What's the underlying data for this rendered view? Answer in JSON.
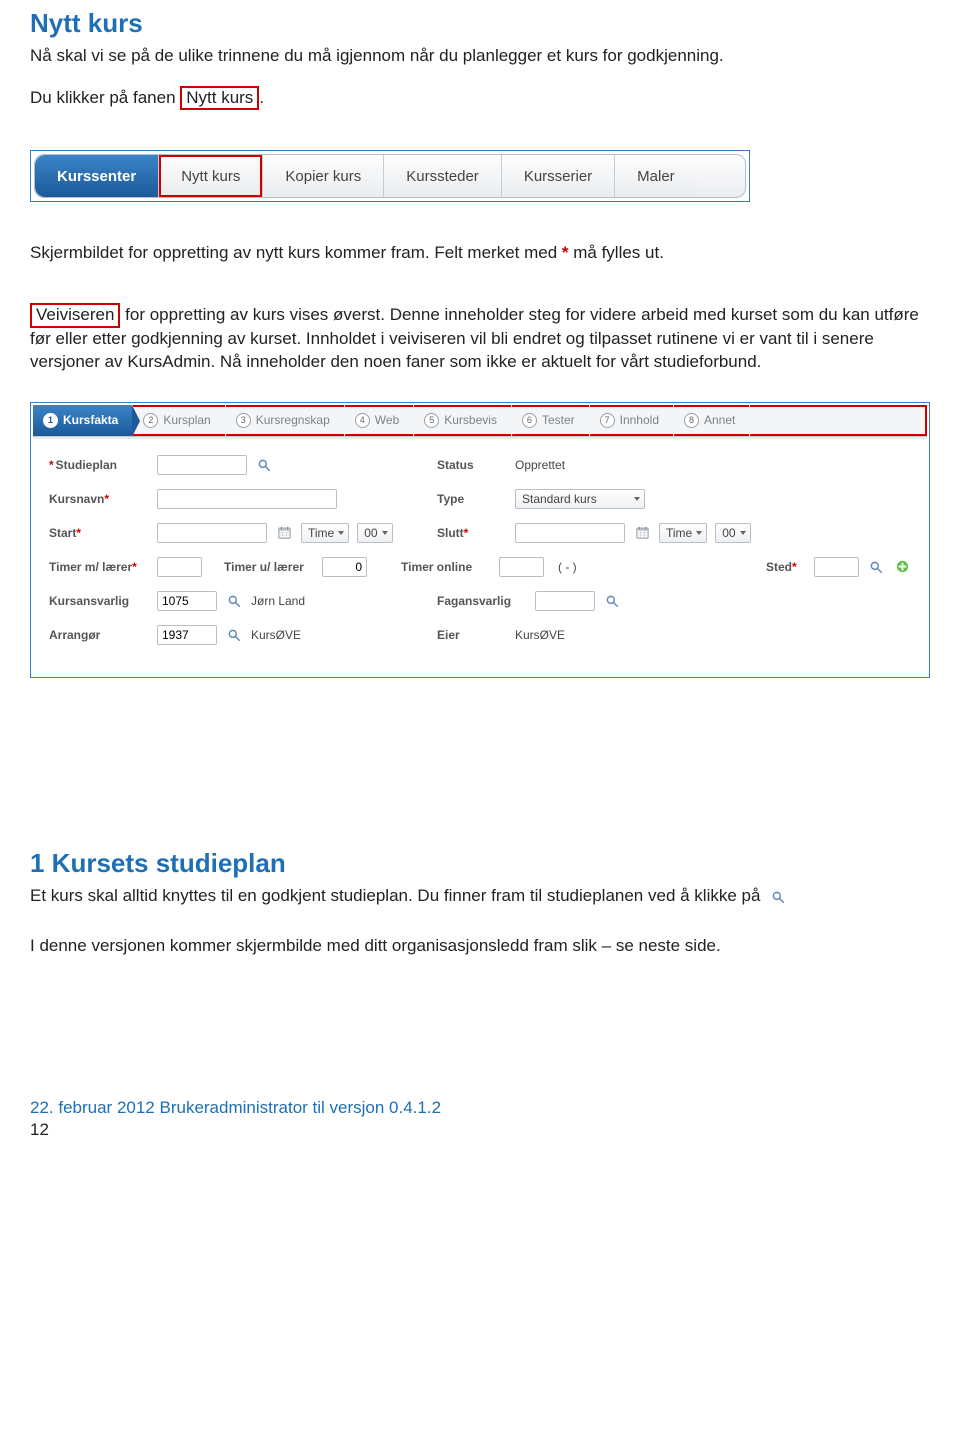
{
  "heading1": "Nytt kurs",
  "para1": "Nå skal vi se på de ulike trinnene du må igjennom når du planlegger et kurs for godkjenning.",
  "para2_pre": "Du klikker på fanen ",
  "para2_box": "Nytt kurs",
  "para2_post": ".",
  "tabs": [
    {
      "label": "Kurssenter",
      "active": true
    },
    {
      "label": "Nytt kurs",
      "highlighted": true
    },
    {
      "label": "Kopier kurs"
    },
    {
      "label": "Kurssteder"
    },
    {
      "label": "Kursserier"
    },
    {
      "label": "Maler"
    }
  ],
  "para3_pre": "Skjermbildet for oppretting av nytt kurs kommer fram. Felt merket med ",
  "para3_star": "*",
  "para3_post": " må fylles ut.",
  "para4_box": "Veiviseren",
  "para4_rest": " for oppretting av kurs vises øverst. Denne inneholder steg for videre arbeid med kurset som du kan utføre før eller etter godkjenning av kurset. Innholdet i veiviseren vil bli endret og tilpasset rutinene vi er vant til i senere versjoner av KursAdmin. Nå inneholder den noen faner som ikke er aktuelt for vårt studieforbund.",
  "wizard_steps": [
    {
      "n": "1",
      "label": "Kursfakta",
      "active": true
    },
    {
      "n": "2",
      "label": "Kursplan"
    },
    {
      "n": "3",
      "label": "Kursregnskap"
    },
    {
      "n": "4",
      "label": "Web"
    },
    {
      "n": "5",
      "label": "Kursbevis"
    },
    {
      "n": "6",
      "label": "Tester"
    },
    {
      "n": "7",
      "label": "Innhold"
    },
    {
      "n": "8",
      "label": "Annet"
    }
  ],
  "form": {
    "studieplan_label": "Studieplan",
    "status_label": "Status",
    "status_value": "Opprettet",
    "kursnavn_label": "Kursnavn",
    "type_label": "Type",
    "type_value": "Standard kurs",
    "start_label": "Start",
    "slutt_label": "Slutt",
    "time_label": "Time",
    "hh_value": "00",
    "timer_m_label": "Timer m/ lærer",
    "timer_u_label": "Timer u/ lærer",
    "timer_u_value": "0",
    "timer_online_label": "Timer online",
    "timer_online_value": "( - )",
    "sted_label": "Sted",
    "kursansvarlig_label": "Kursansvarlig",
    "kursansvarlig_id": "1075",
    "kursansvarlig_name": "Jørn Land",
    "fagansvarlig_label": "Fagansvarlig",
    "arrangor_label": "Arrangør",
    "arrangor_id": "1937",
    "arrangor_name": "KursØVE",
    "eier_label": "Eier",
    "eier_value": "KursØVE"
  },
  "heading2": "1 Kursets studieplan",
  "para5": "Et kurs skal alltid knyttes til en godkjent studieplan. Du finner fram til studieplanen ved å klikke på",
  "para6": "I denne versjonen kommer skjermbilde med ditt organisasjonsledd fram slik – se neste side.",
  "footer_line": "22. februar 2012 Brukeradministrator til versjon 0.4.1.2",
  "footer_page": "12"
}
